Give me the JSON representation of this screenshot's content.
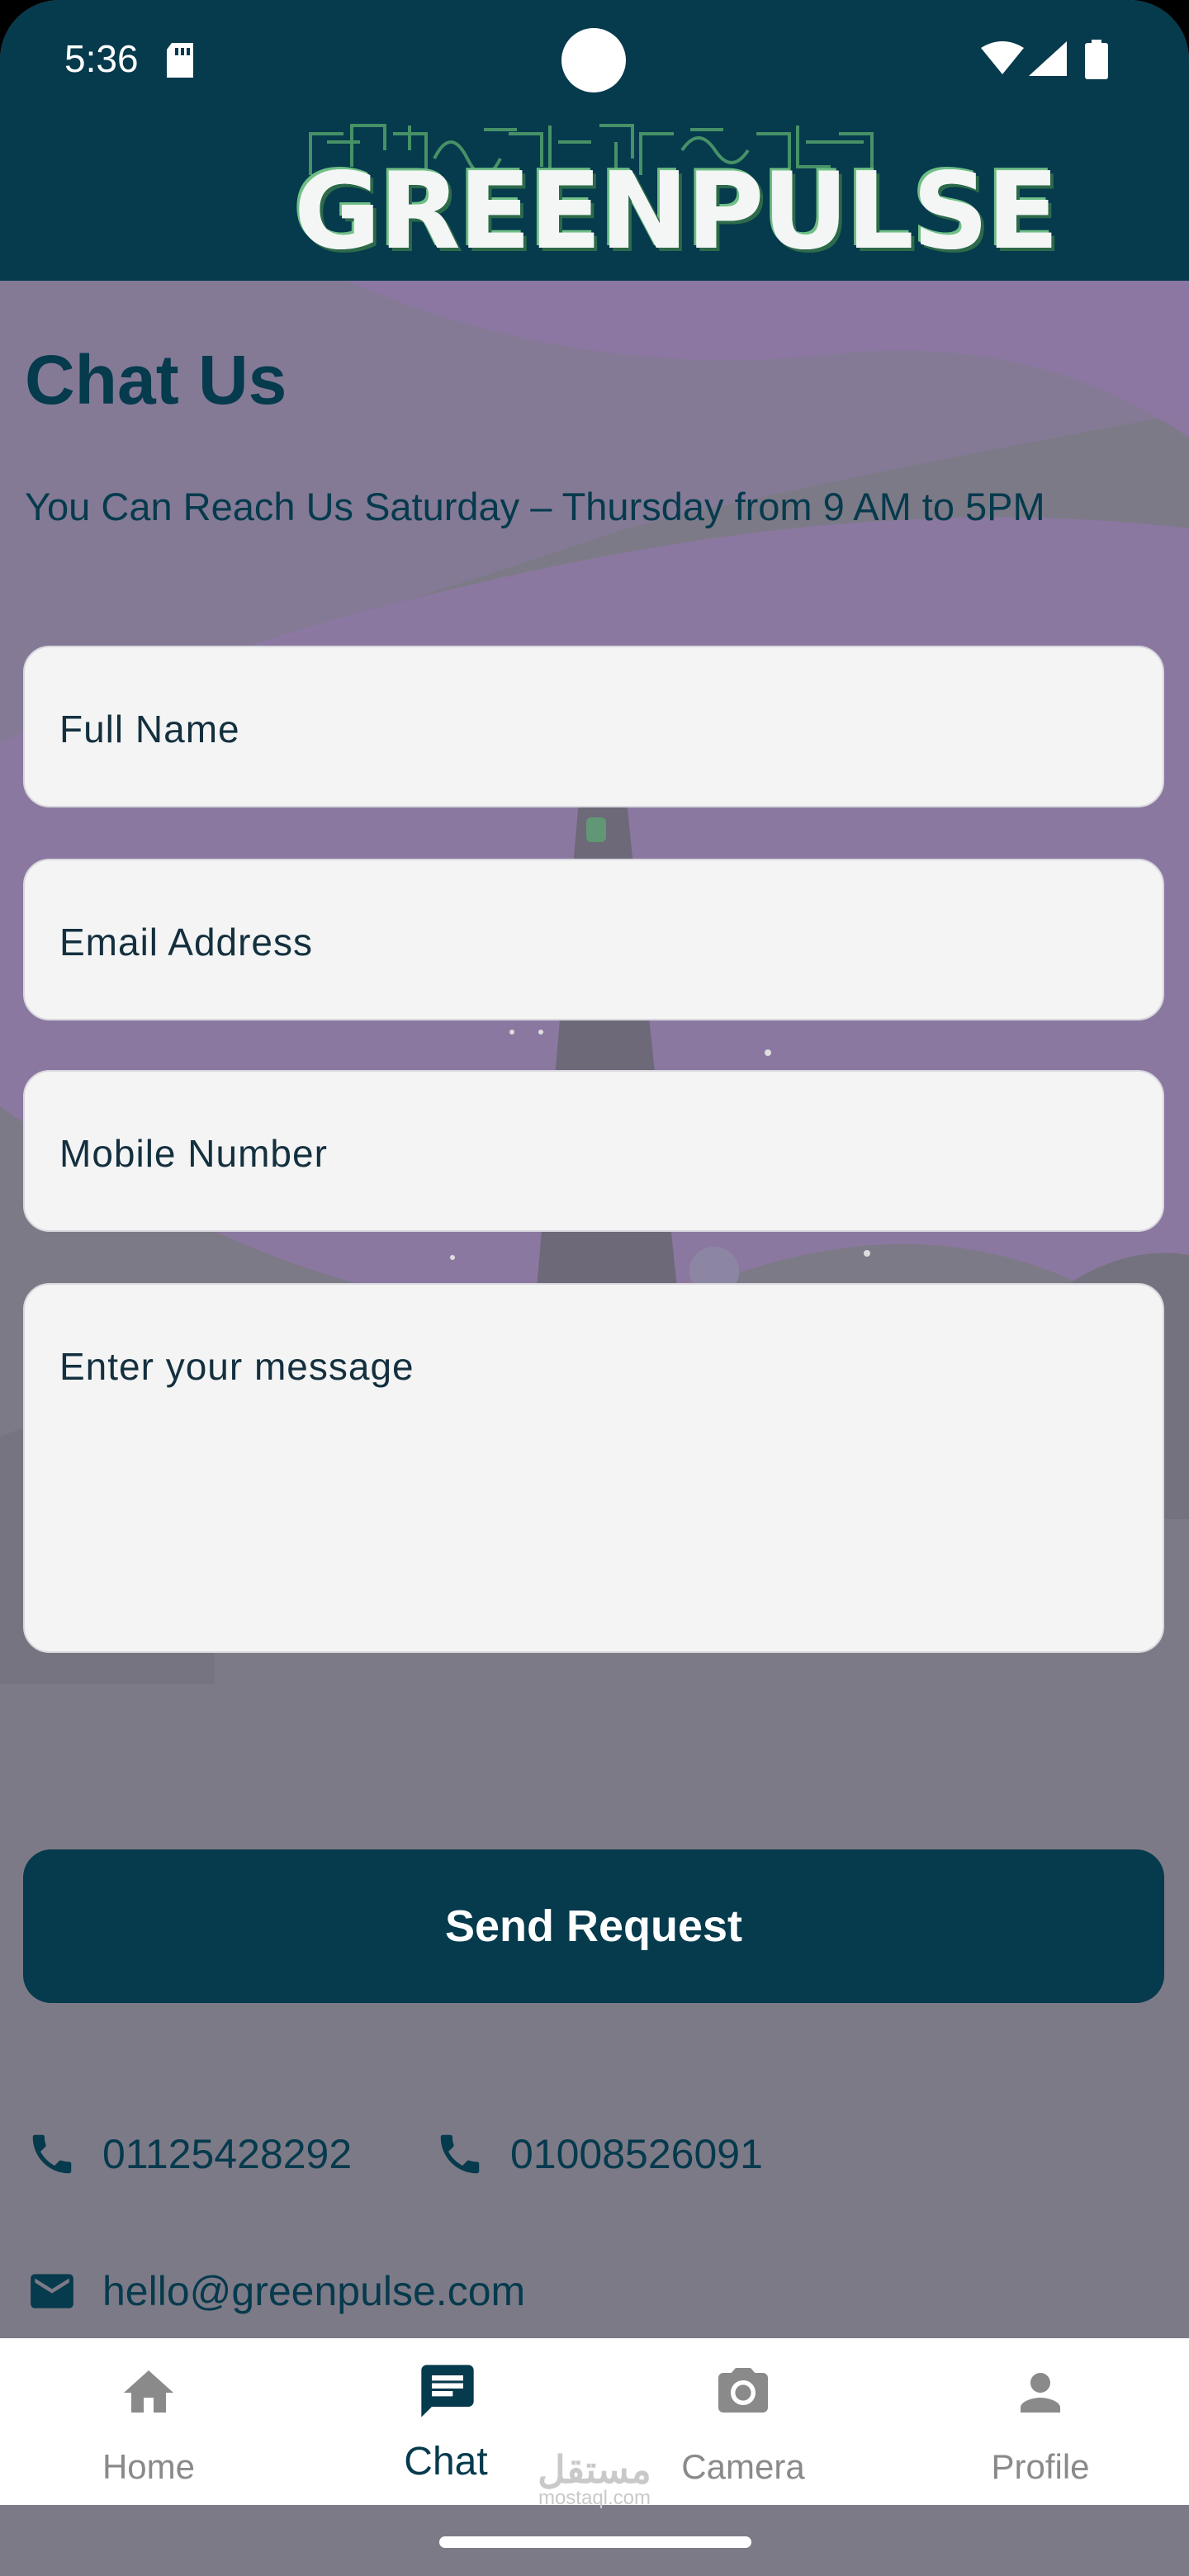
{
  "status_bar": {
    "time": "5:36"
  },
  "header": {
    "logo_text": "GREENPULSE"
  },
  "page": {
    "title": "Chat Us",
    "subtitle": "You Can Reach Us Saturday – Thursday from 9 AM to 5PM"
  },
  "form": {
    "full_name_placeholder": "Full Name",
    "email_placeholder": "Email Address",
    "mobile_placeholder": "Mobile Number",
    "message_placeholder": "Enter your message",
    "send_label": "Send Request"
  },
  "contact": {
    "phone_1": "01125428292",
    "phone_2": "01008526091",
    "email": "hello@greenpulse.com"
  },
  "nav": {
    "items": [
      {
        "label": "Home",
        "icon": "home-icon",
        "active": false
      },
      {
        "label": "Chat",
        "icon": "chat-icon",
        "active": true
      },
      {
        "label": "Camera",
        "icon": "camera-icon",
        "active": false
      },
      {
        "label": "Profile",
        "icon": "profile-icon",
        "active": false
      }
    ]
  },
  "watermark": {
    "arabic": "مستقل",
    "latin": "mostaql.com"
  },
  "colors": {
    "primary": "#063a4d",
    "background": "#7d7a87",
    "field": "#f4f4f4",
    "nav_inactive": "#8a8a8a"
  }
}
